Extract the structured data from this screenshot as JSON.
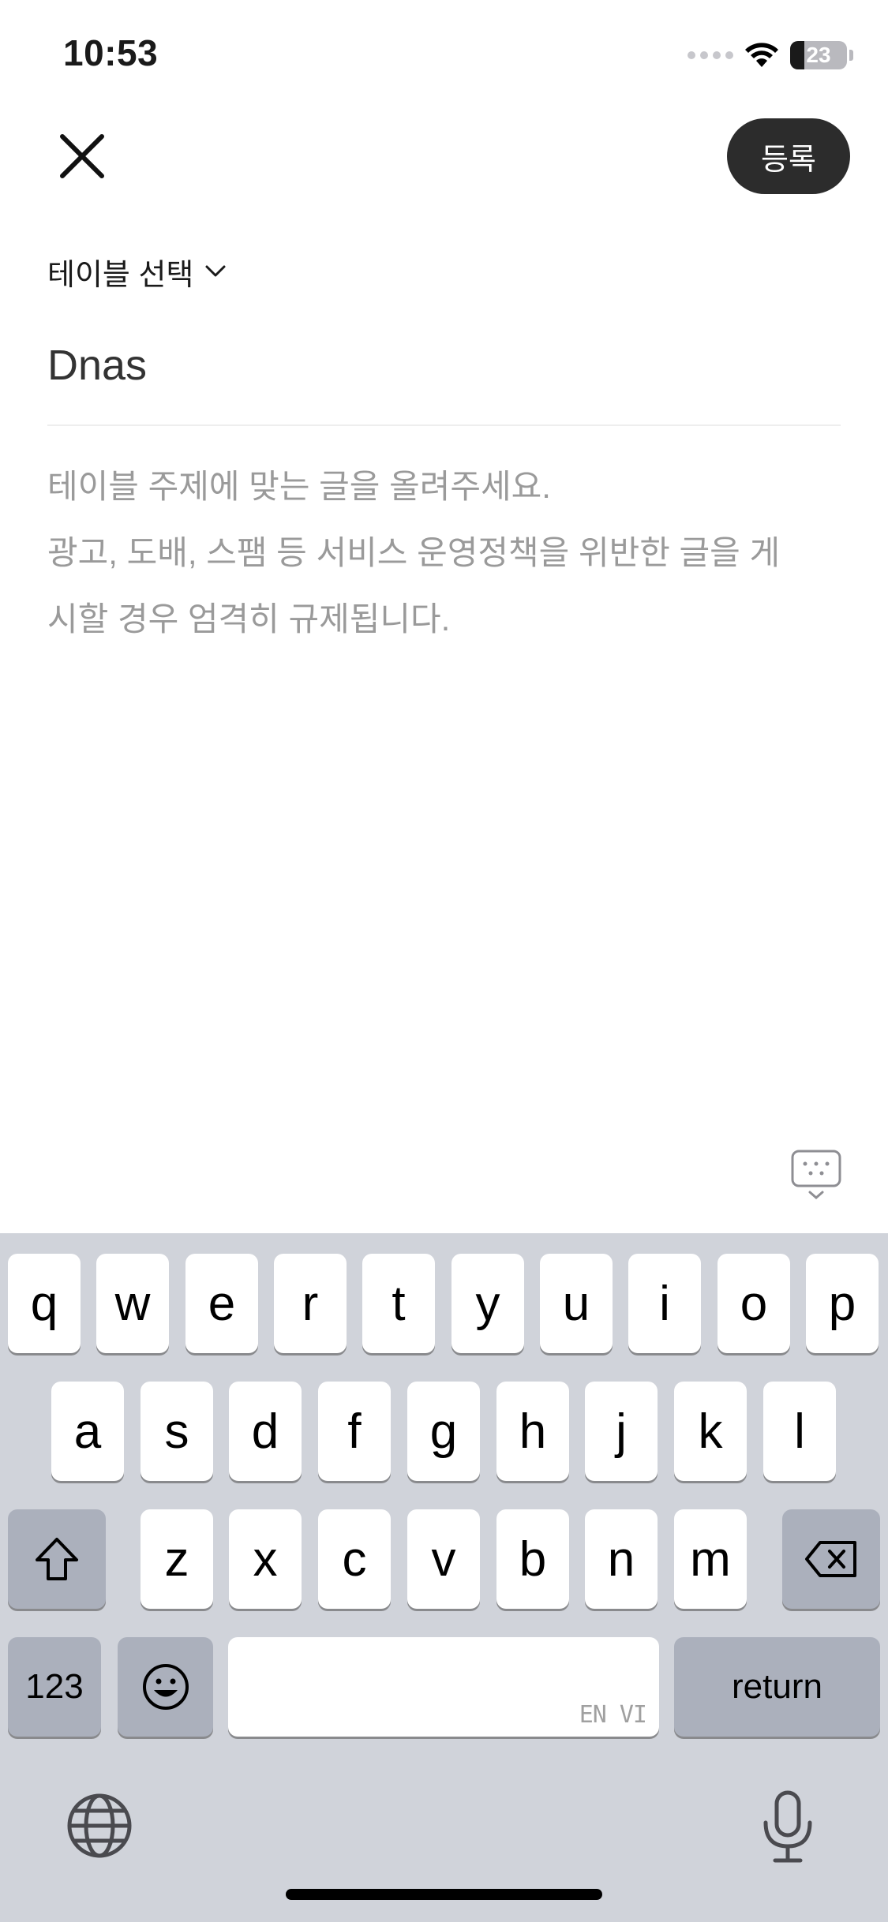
{
  "status_bar": {
    "time": "10:53",
    "battery": "23"
  },
  "header": {
    "submit_label": "등록"
  },
  "table_select": {
    "label": "테이블 선택"
  },
  "post": {
    "title_value": "Dnas",
    "body_placeholder": "테이블 주제에 맞는 글을 올려주세요.\n광고, 도배, 스팸 등 서비스 운영정책을 위반한 글을 게\n시할 경우 엄격히 규제됩니다."
  },
  "keyboard": {
    "row1": [
      "q",
      "w",
      "e",
      "r",
      "t",
      "y",
      "u",
      "i",
      "o",
      "p"
    ],
    "row2": [
      "a",
      "s",
      "d",
      "f",
      "g",
      "h",
      "j",
      "k",
      "l"
    ],
    "row3": [
      "z",
      "x",
      "c",
      "v",
      "b",
      "n",
      "m"
    ],
    "numbers_label": "123",
    "return_label": "return",
    "space_hint": "EN VI"
  },
  "colors": {
    "submit_bg": "#2c2c2c",
    "keyboard_bg": "#d0d3da",
    "placeholder": "#9a9a9a"
  }
}
